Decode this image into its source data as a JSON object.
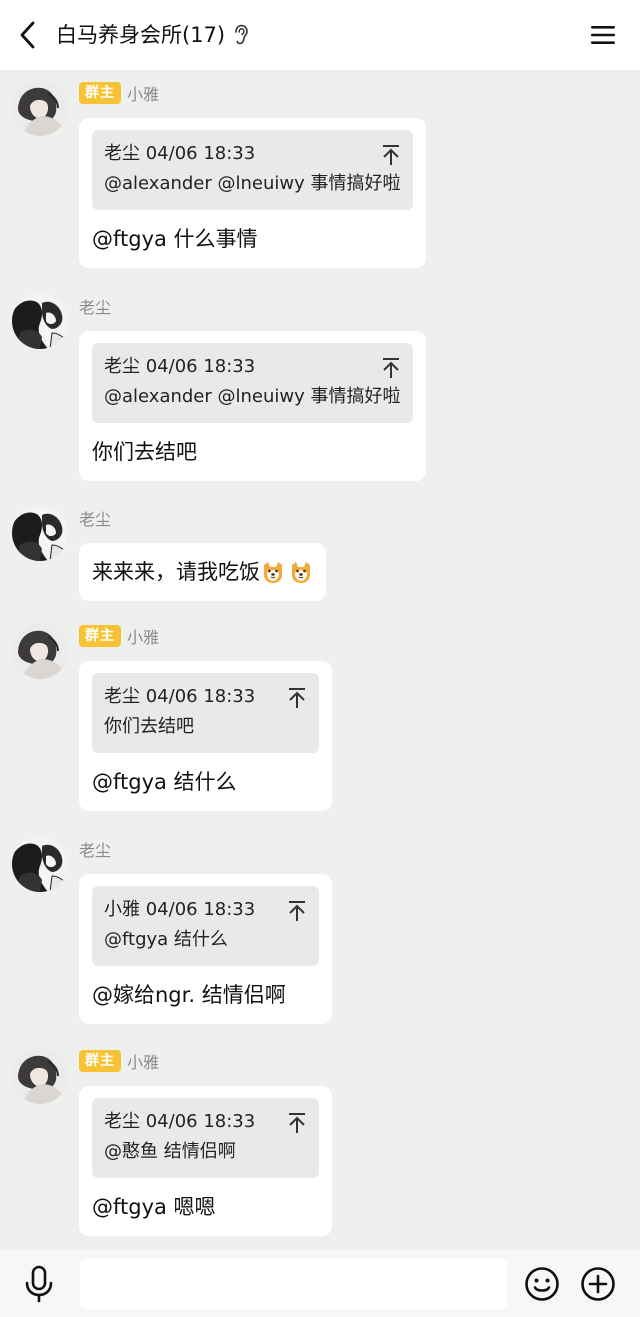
{
  "header": {
    "title": "白马养身会所(17)",
    "back_icon": "chevron-left-icon",
    "mode_icon": "ear-icon",
    "menu_icon": "hamburger-menu-icon"
  },
  "badge_label": "群主",
  "messages": [
    {
      "sender": "小雅",
      "is_owner": true,
      "avatar": "avatar-xiaoya",
      "quote": {
        "author_time": "老尘 04/06 18:33",
        "text": "@alexander @lneuiwy 事情搞好啦"
      },
      "text": "@ftgya 什么事情"
    },
    {
      "sender": "老尘",
      "is_owner": false,
      "avatar": "avatar-laochen",
      "quote": {
        "author_time": "老尘 04/06 18:33",
        "text": "@alexander @lneuiwy 事情搞好啦"
      },
      "text": "你们去结吧"
    },
    {
      "sender": "老尘",
      "is_owner": false,
      "avatar": "avatar-laochen",
      "text": "来来来，请我吃饭",
      "emojis": [
        "dog-face-emoji",
        "dog-face-emoji"
      ]
    },
    {
      "sender": "小雅",
      "is_owner": true,
      "avatar": "avatar-xiaoya",
      "quote": {
        "author_time": "老尘 04/06 18:33",
        "text": "你们去结吧"
      },
      "text": "@ftgya 结什么"
    },
    {
      "sender": "老尘",
      "is_owner": false,
      "avatar": "avatar-laochen",
      "quote": {
        "author_time": "小雅 04/06 18:33",
        "text": "@ftgya 结什么"
      },
      "text": "@嫁给ngr. 结情侣啊"
    },
    {
      "sender": "小雅",
      "is_owner": true,
      "avatar": "avatar-xiaoya",
      "quote": {
        "author_time": "老尘 04/06 18:33",
        "text": "@憨鱼 结情侣啊"
      },
      "text": "@ftgya 嗯嗯"
    }
  ],
  "input_bar": {
    "voice_icon": "microphone-icon",
    "emoji_icon": "smiley-icon",
    "plus_icon": "plus-circle-icon",
    "placeholder": ""
  },
  "colors": {
    "background": "#edf0ec",
    "bubble": "#ffffff",
    "quote": "#e9e9e9",
    "owner_badge": "#f7c233",
    "name": "#8a8a8a"
  }
}
